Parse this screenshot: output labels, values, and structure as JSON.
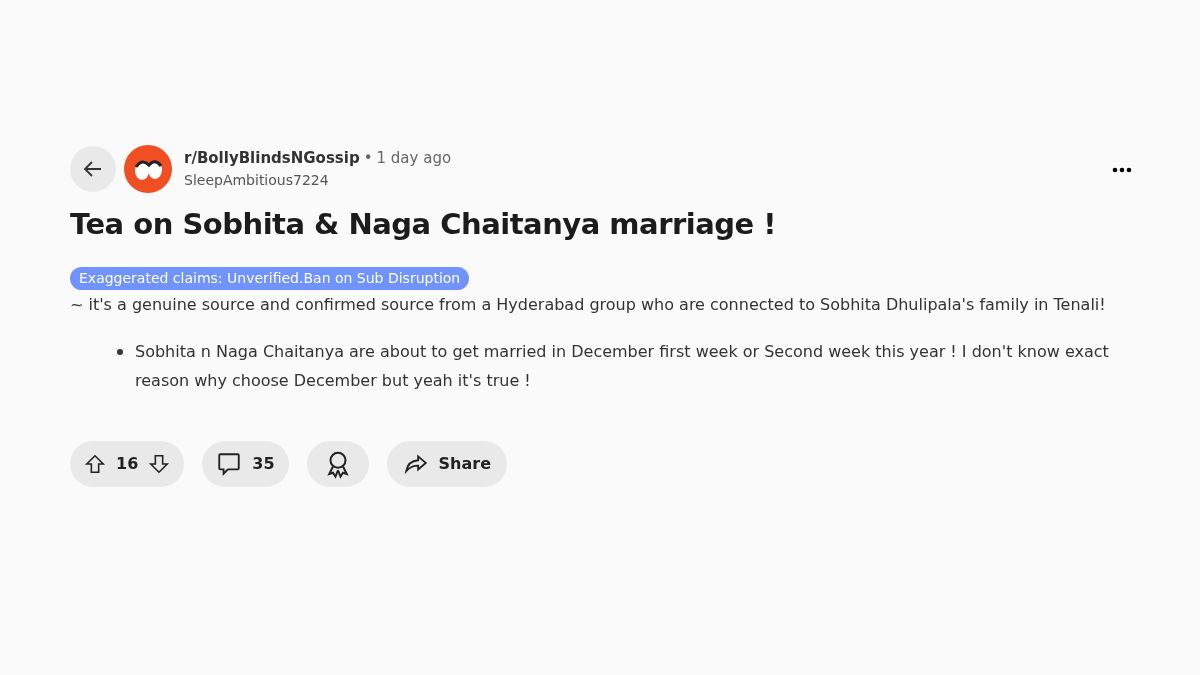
{
  "post": {
    "subreddit": "r/BollyBlindsNGossip",
    "separator": "•",
    "time": "1 day ago",
    "author": "SleepAmbitious7224",
    "title": "Tea on Sobhita & Naga Chaitanya marriage !",
    "flair": {
      "text": "Exaggerated claims: Unverified.Ban on Sub Disruption",
      "color": "#7193ff"
    },
    "body": "~ it's a genuine source and confirmed source from a Hyderabad group who are connected to Sobhita Dhulipala's family in Tenali!",
    "bullets": [
      "Sobhita n Naga Chaitanya are about to get married in December first week or Second week this year ! I don't know exact reason why choose December but yeah it's true !"
    ]
  },
  "actions": {
    "votes": "16",
    "comments": "35",
    "share": "Share"
  }
}
